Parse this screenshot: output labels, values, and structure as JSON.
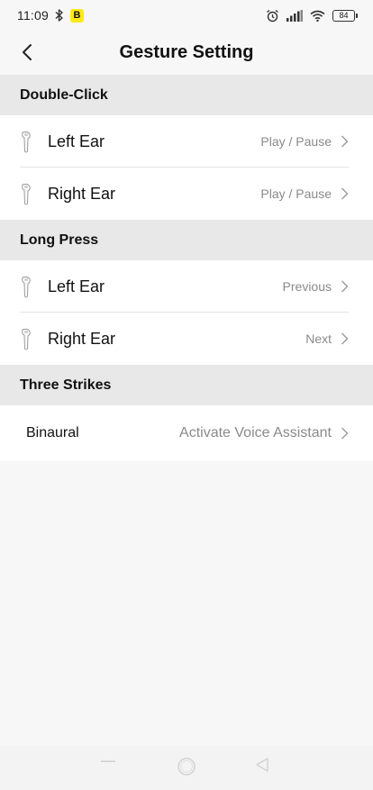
{
  "status_bar": {
    "time": "11:09",
    "badge": "B",
    "battery": "84",
    "badge_color": "#ffe817"
  },
  "header": {
    "title": "Gesture Setting",
    "back_icon": "chevron-left-icon"
  },
  "sections": {
    "double_click": {
      "title": "Double-Click",
      "left_label": "Left Ear",
      "left_value": "Play / Pause",
      "right_label": "Right Ear",
      "right_value": "Play / Pause"
    },
    "long_press": {
      "title": "Long Press",
      "left_label": "Left Ear",
      "left_value": "Previous",
      "right_label": "Right Ear",
      "right_value": "Next"
    },
    "three_strikes": {
      "title": "Three Strikes",
      "binaural_label": "Binaural",
      "binaural_value": "Activate Voice Assistant"
    }
  },
  "nav_bar": {
    "icons": [
      "menu-icon",
      "home-icon",
      "back-triangle-icon"
    ]
  },
  "colors": {
    "background": "#f7f7f7",
    "section_header_bg": "#e8e8e8",
    "row_bg": "#ffffff",
    "value_text": "#8a8a8a"
  }
}
